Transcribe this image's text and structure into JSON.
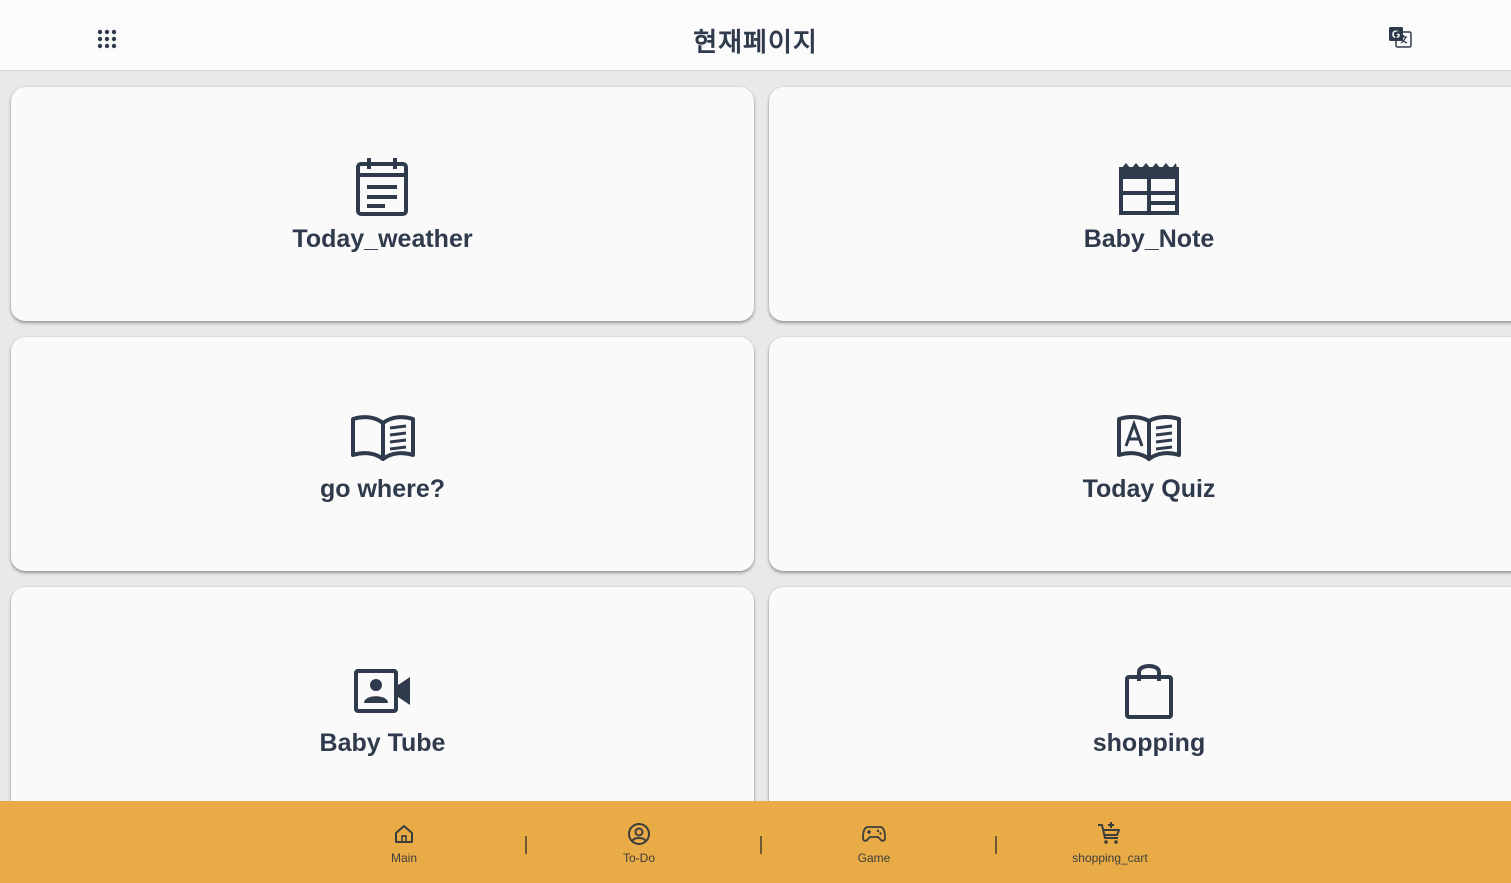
{
  "header": {
    "title": "현재페이지",
    "menu_icon": "apps-grid-icon",
    "translate_icon": "translate-icon"
  },
  "cards": [
    {
      "label": "Today_weather",
      "icon": "calendar-note-icon"
    },
    {
      "label": "Baby_Note",
      "icon": "calendar-table-icon"
    },
    {
      "label": "go where?",
      "icon": "open-book-icon"
    },
    {
      "label": "Today Quiz",
      "icon": "book-a-icon"
    },
    {
      "label": "Baby Tube",
      "icon": "video-camera-icon"
    },
    {
      "label": "shopping",
      "icon": "shopping-bag-icon"
    }
  ],
  "bottom_nav": {
    "items": [
      {
        "label": "Main",
        "icon": "home-icon"
      },
      {
        "label": "To-Do",
        "icon": "user-circle-icon"
      },
      {
        "label": "Game",
        "icon": "gamepad-icon"
      },
      {
        "label": "shopping_cart",
        "icon": "cart-add-icon"
      }
    ]
  },
  "colors": {
    "bottom_bar": "#e8ab45",
    "text_dark": "#2f3b4c",
    "card_bg": "#fafafa",
    "page_bg": "#e9e9e9"
  }
}
